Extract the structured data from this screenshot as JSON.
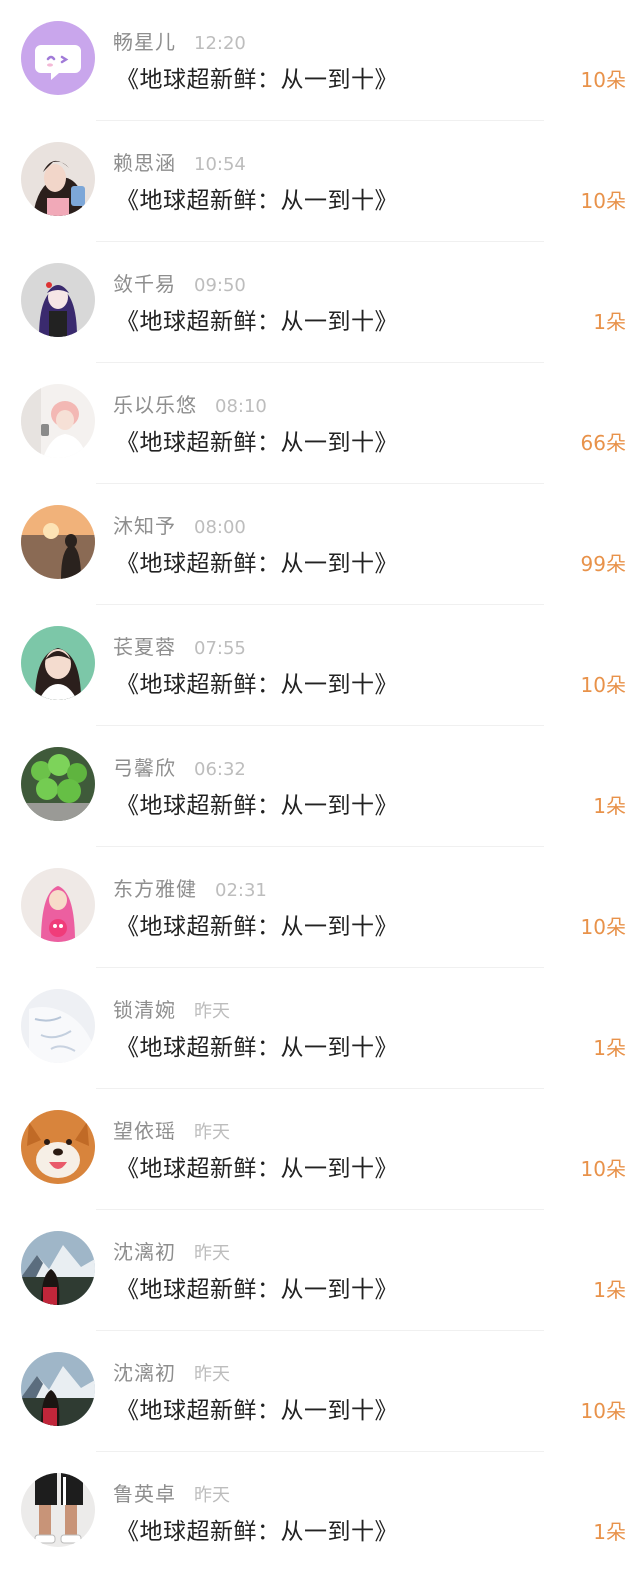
{
  "colors": {
    "accent": "#e8924a",
    "name": "#8e8e8e",
    "time": "#bdbdbd",
    "title": "#222222"
  },
  "items": [
    {
      "name": "畅星儿",
      "time": "12:20",
      "title": "《地球超新鲜：从一到十》",
      "count": "10朵",
      "avatar": "chat-bubble-icon"
    },
    {
      "name": "赖思涵",
      "time": "10:54",
      "title": "《地球超新鲜：从一到十》",
      "count": "10朵",
      "avatar": "girl-photo"
    },
    {
      "name": "敛千易",
      "time": "09:50",
      "title": "《地球超新鲜：从一到十》",
      "count": "1朵",
      "avatar": "anime-girl"
    },
    {
      "name": "乐以乐悠",
      "time": "08:10",
      "title": "《地球超新鲜：从一到十》",
      "count": "66朵",
      "avatar": "pink-hair-photo"
    },
    {
      "name": "沐知予",
      "time": "08:00",
      "title": "《地球超新鲜：从一到十》",
      "count": "99朵",
      "avatar": "sunset-photo"
    },
    {
      "name": "苌夏蓉",
      "time": "07:55",
      "title": "《地球超新鲜：从一到十》",
      "count": "10朵",
      "avatar": "girl-portrait"
    },
    {
      "name": "弓馨欣",
      "time": "06:32",
      "title": "《地球超新鲜：从一到十》",
      "count": "1朵",
      "avatar": "clover-photo"
    },
    {
      "name": "东方雅健",
      "time": "02:31",
      "title": "《地球超新鲜：从一到十》",
      "count": "10朵",
      "avatar": "baby-photo"
    },
    {
      "name": "锁清婉",
      "time": "昨天",
      "title": "《地球超新鲜：从一到十》",
      "count": "1朵",
      "avatar": "white-cloth-photo"
    },
    {
      "name": "望依瑶",
      "time": "昨天",
      "title": "《地球超新鲜：从一到十》",
      "count": "10朵",
      "avatar": "shiba-dog-photo"
    },
    {
      "name": "沈漓初",
      "time": "昨天",
      "title": "《地球超新鲜：从一到十》",
      "count": "1朵",
      "avatar": "mountain-photo"
    },
    {
      "name": "沈漓初",
      "time": "昨天",
      "title": "《地球超新鲜：从一到十》",
      "count": "10朵",
      "avatar": "mountain-photo"
    },
    {
      "name": "鲁英卓",
      "time": "昨天",
      "title": "《地球超新鲜：从一到十》",
      "count": "1朵",
      "avatar": "legs-photo"
    }
  ]
}
